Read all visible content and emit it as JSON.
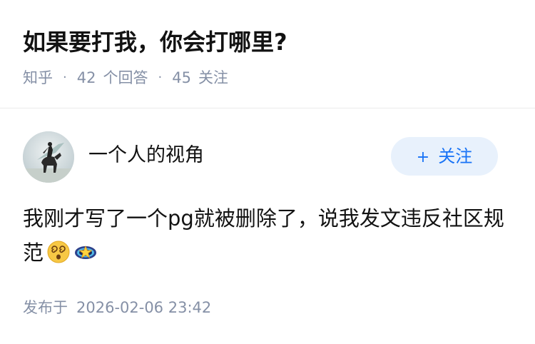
{
  "question": {
    "title": "如果要打我，你会打哪里?",
    "source": "知乎",
    "answer_count": "42",
    "answer_label": "个回答",
    "follow_count": "45",
    "follow_label": "关注"
  },
  "answer": {
    "author": {
      "name": "一个人的视角",
      "avatar_icon": "avatar-horse-rider-icon"
    },
    "follow_button": {
      "plus": "+",
      "label": "关注"
    },
    "content": "我刚才写了一个pg就被删除了，说我发文违反社区规范",
    "emojis": [
      "dizzy-face-icon",
      "star-ring-icon"
    ],
    "publish_label": "发布于",
    "publish_time": "2026-02-06 23:42"
  },
  "colors": {
    "title": "#121212",
    "meta": "#8590a6",
    "follow_bg": "#e8f1fc",
    "follow_text": "#1772f6"
  }
}
